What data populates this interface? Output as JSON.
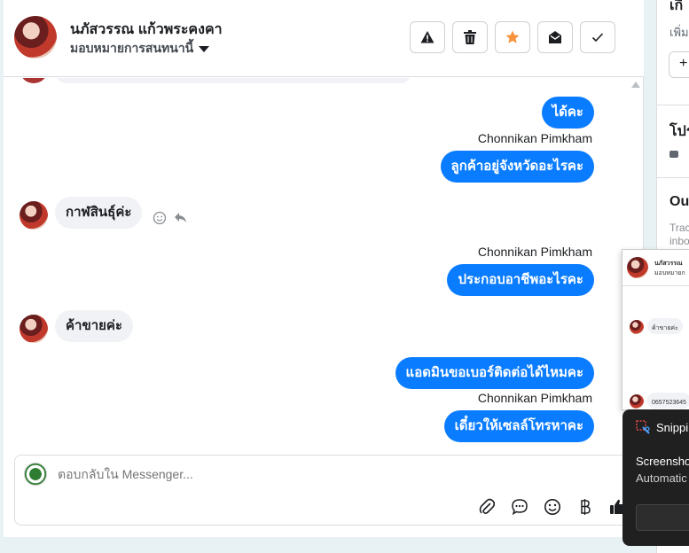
{
  "header": {
    "contact_name": "นภัสวรรณ แก้วพระคงคา",
    "assign_label": "มอบหมายการสนทนานี้",
    "actions": [
      {
        "name": "report-button",
        "icon": "warning-icon"
      },
      {
        "name": "delete-button",
        "icon": "trash-icon"
      },
      {
        "name": "star-button",
        "icon": "star-icon"
      },
      {
        "name": "mark-unread-button",
        "icon": "envelope-open-icon"
      },
      {
        "name": "mark-done-button",
        "icon": "check-icon"
      }
    ]
  },
  "messages": [
    {
      "from": "page",
      "text": "ได้คะ"
    },
    {
      "from": "page",
      "sender": "Chonnikan Pimkham",
      "text": "ลูกค้าอยู่จังหวัดอะไรคะ"
    },
    {
      "from": "customer",
      "text": "กาฬสินธุ์ค่ะ"
    },
    {
      "from": "page",
      "sender": "Chonnikan Pimkham",
      "text": "ประกอบอาชีพอะไรคะ"
    },
    {
      "from": "customer",
      "text": "ค้าขายค่ะ"
    },
    {
      "from": "page",
      "text": "แอดมินขอเบอร์ติดต่อได้ไหมคะ"
    },
    {
      "from": "page",
      "sender": "Chonnikan Pimkham",
      "text": "เดี๋ยวให้เซลล์โทรหาคะ"
    }
  ],
  "composer": {
    "placeholder": "ตอบกลับใน Messenger...",
    "tools": [
      "attachment-icon",
      "saved-reply-icon",
      "emoji-icon",
      "baht-icon",
      "thumbs-up-icon"
    ]
  },
  "right_panel": {
    "top_partial": "เกี",
    "add_partial": "เพิ่ม",
    "plus": "+",
    "section_partial": "โปร",
    "outcome_partial": "Out",
    "trac_partial": "Trac",
    "inbo_partial": "inbo"
  },
  "preview": {
    "name_partial": "นภัสวรรณ",
    "assign_partial": "มอบหมายก",
    "msg1": "ค้าขายค่ะ",
    "msg2": "0657523645"
  },
  "toast": {
    "app": "Snippi",
    "line1": "Screensho",
    "line2": "Automatic"
  },
  "colors": {
    "outgoing_bubble": "#0a7cff",
    "incoming_bubble": "#f0f2f5",
    "star": "#f7923a"
  }
}
